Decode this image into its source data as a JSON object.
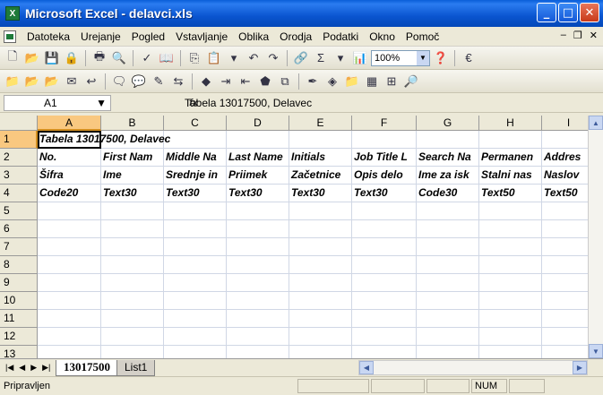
{
  "window": {
    "title": "Microsoft Excel - delavci.xls",
    "app_icon": "X"
  },
  "menu": {
    "items": [
      "Datoteka",
      "Urejanje",
      "Pogled",
      "Vstavljanje",
      "Oblika",
      "Orodja",
      "Podatki",
      "Okno",
      "Pomoč"
    ]
  },
  "toolbar": {
    "zoom": "100%",
    "currency": "€"
  },
  "formula": {
    "name_box": "A1",
    "fx": "fx",
    "content": "Tabela 13017500, Delavec"
  },
  "grid": {
    "columns": [
      "A",
      "B",
      "C",
      "D",
      "E",
      "F",
      "G",
      "H",
      "I"
    ],
    "rows": [
      "1",
      "2",
      "3",
      "4",
      "5",
      "6",
      "7",
      "8",
      "9",
      "10",
      "11",
      "12",
      "13"
    ],
    "cells": {
      "r1": [
        "Tabela 13017500, Delavec"
      ],
      "r2": [
        "No.",
        "First Nam",
        "Middle Na",
        "Last Name",
        "Initials",
        "Job Title L",
        "Search Na",
        "Permanen",
        "Addres"
      ],
      "r3": [
        "Šifra",
        "Ime",
        "Srednje in",
        "Priimek",
        "Začetnice",
        "Opis delo",
        "Ime za isk",
        "Stalni nas",
        "Naslov"
      ],
      "r4": [
        "Code20",
        "Text30",
        "Text30",
        "Text30",
        "Text30",
        "Text30",
        "Code30",
        "Text50",
        "Text50"
      ]
    }
  },
  "sheets": {
    "tabs": [
      "13017500",
      "List1"
    ],
    "active": "13017500"
  },
  "status": {
    "text": "Pripravljen",
    "num": "NUM"
  },
  "colors": {
    "title_bar": "#0a55d0",
    "selected_header": "#f9c880",
    "gridline": "#d0d7e5"
  }
}
